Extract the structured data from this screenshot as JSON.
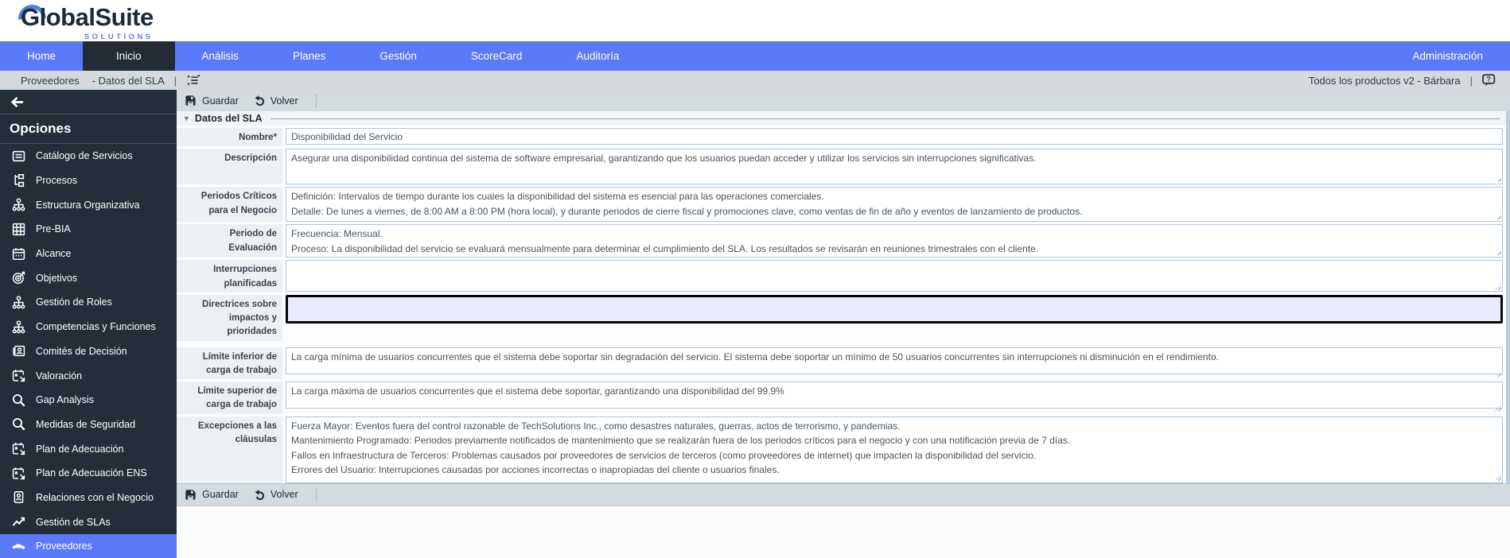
{
  "header": {
    "logo": {
      "main": "GlobalSuite",
      "sub": "SOLUTIONS"
    }
  },
  "nav": {
    "tabs": [
      {
        "label": "Home",
        "active": false
      },
      {
        "label": "Inicio",
        "active": true
      },
      {
        "label": "Análisis",
        "active": false
      },
      {
        "label": "Planes",
        "active": false
      },
      {
        "label": "Gestión",
        "active": false
      },
      {
        "label": "ScoreCard",
        "active": false
      },
      {
        "label": "Auditoría",
        "active": false
      }
    ],
    "right_tab": {
      "label": "Administración"
    }
  },
  "breadcrumb": {
    "module": "Proveedores",
    "page": "- Datos del SLA",
    "separator": "|",
    "right_text": "Todos los productos v2 - Bárbara",
    "right_separator": "|"
  },
  "sidebar": {
    "title": "Opciones",
    "items": [
      {
        "icon": "document-icon",
        "label": "Catálogo de Servicios",
        "active": false
      },
      {
        "icon": "org-chart-icon",
        "label": "Procesos",
        "active": false
      },
      {
        "icon": "hierarchy-icon",
        "label": "Estructura Organizativa",
        "active": false
      },
      {
        "icon": "grid-icon",
        "label": "Pre-BIA",
        "active": false
      },
      {
        "icon": "calendar-icon",
        "label": "Alcance",
        "active": false
      },
      {
        "icon": "target-icon",
        "label": "Objetivos",
        "active": false
      },
      {
        "icon": "hierarchy-icon",
        "label": "Gestión de Roles",
        "active": false
      },
      {
        "icon": "hierarchy-icon",
        "label": "Competencias y Funciones",
        "active": false
      },
      {
        "icon": "id-card-icon",
        "label": "Comités de Decisión",
        "active": false
      },
      {
        "icon": "calendar-select-icon",
        "label": "Valoración",
        "active": false
      },
      {
        "icon": "search-icon",
        "label": "Gap Analysis",
        "active": false
      },
      {
        "icon": "search-icon",
        "label": "Medidas de Seguridad",
        "active": false
      },
      {
        "icon": "calendar-select-icon",
        "label": "Plan de Adecuación",
        "active": false
      },
      {
        "icon": "calendar-select-icon",
        "label": "Plan de Adecuación ENS",
        "active": false
      },
      {
        "icon": "badge-person-icon",
        "label": "Relaciones con el Negocio",
        "active": false
      },
      {
        "icon": "trend-icon",
        "label": "Gestión de SLAs",
        "active": false
      },
      {
        "icon": "handshake-icon",
        "label": "Proveedores",
        "active": true
      }
    ]
  },
  "toolbar": {
    "save_label": "Guardar",
    "back_label": "Volver"
  },
  "form": {
    "section_title": "Datos del SLA",
    "fields": [
      {
        "label": "Nombre*",
        "value": "Disponibilidad del Servicio",
        "focused": false
      },
      {
        "label": "Descripción",
        "value": "Asegurar una disponibilidad continua del sistema de software empresarial, garantizando que los usuarios puedan acceder y utilizar los servicios sin interrupciones significativas.",
        "focused": false
      },
      {
        "label": "Periodos Críticos para el Negocio",
        "value": "Definición: Intervalos de tiempo durante los cuales la disponibilidad del sistema es esencial para las operaciones comerciales.\nDetalle: De lunes a viernes, de 8:00 AM a 8:00 PM (hora local), y durante periodos de cierre fiscal y promociones clave, como ventas de fin de año y eventos de lanzamiento de productos.",
        "focused": false
      },
      {
        "label": "Periodo de Evaluación",
        "value": "Frecuencia: Mensual.\nProceso: La disponibilidad del servicio se evaluará mensualmente para determinar el cumplimiento del SLA. Los resultados se revisarán en reuniones trimestrales con el cliente.",
        "focused": false
      },
      {
        "label": "Interrupciones planificadas",
        "value": "",
        "focused": false
      },
      {
        "label": "Directrices sobre impactos y prioridades",
        "value": "",
        "focused": true
      },
      {
        "label": "Límite inferior de carga de trabajo",
        "value": "La carga mínima de usuarios concurrentes que el sistema debe soportar sin degradación del servicio. El sistema debe soportar un mínimo de 50 usuarios concurrentes sin interrupciones ni disminución en el rendimiento.",
        "focused": false
      },
      {
        "label": "Límite superior de carga de trabajo",
        "value": "La carga máxima de usuarios concurrentes que el sistema debe soportar, garantizando una disponibilidad del 99.9%",
        "focused": false
      },
      {
        "label": "Excepciones a las cláusulas",
        "value": "Fuerza Mayor: Eventos fuera del control razonable de TechSolutions Inc., como desastres naturales, guerras, actos de terrorismo, y pandemias.\nMantenimiento Programado: Periodos previamente notificados de mantenimiento que se realizarán fuera de los periodos críticos para el negocio y con una notificación previa de 7 días.\nFallos en Infraestructura de Terceros: Problemas causados por proveedores de servicios de terceros (como proveedores de internet) que impacten la disponibilidad del servicio.\nErrores del Usuario: Interrupciones causadas por acciones incorrectas o inapropiadas del cliente o usuarios finales.",
        "focused": false
      }
    ]
  },
  "colors": {
    "nav_blue": "#5b7afa",
    "sidebar_dark": "#242d39",
    "active_tab_dark": "#232b37",
    "breadcrumb_bg": "#d5d9dd",
    "toolbar_bg": "#d3dbdf",
    "field_border": "#a9c6de",
    "focused_field_bg": "#e7ebfb",
    "focus_border": "#060606"
  }
}
